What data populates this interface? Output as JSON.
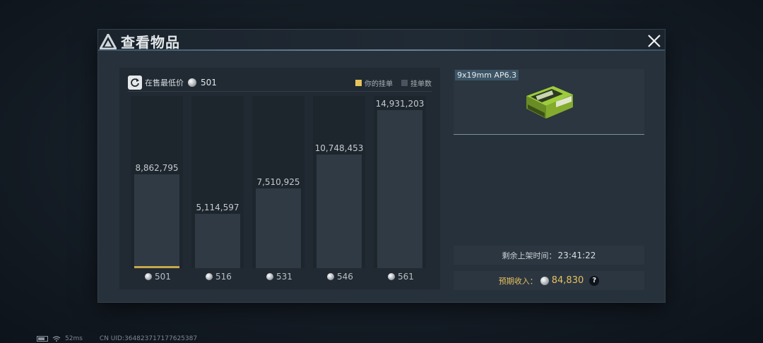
{
  "modal": {
    "title": "查看物品"
  },
  "toolbar": {
    "min_price_label": "在售最低价",
    "min_price_value": "501",
    "legend_mine": "你的挂单",
    "legend_count": "挂单数"
  },
  "chart_data": {
    "type": "bar",
    "categories": [
      "501",
      "516",
      "531",
      "546",
      "561"
    ],
    "values": [
      8862795,
      5114597,
      7510925,
      10748453,
      14931203
    ],
    "value_labels": [
      "8,862,795",
      "5,114,597",
      "7,510,925",
      "10,748,453",
      "14,931,203"
    ],
    "mine_category": "501",
    "ylim": [
      0,
      14931203
    ]
  },
  "item": {
    "name": "9x19mm AP6.3",
    "icon": "ammo-box-icon"
  },
  "timer": {
    "label": "剩余上架时间：",
    "value": "23:41:22"
  },
  "income": {
    "label": "预期收入：",
    "value": "84,830"
  },
  "footer": {
    "ping": "52ms",
    "uid": "CN UID:364823717177625387"
  },
  "colors": {
    "accent": "#e6c15f",
    "bar": "#2f3a44",
    "mine": "#c9a84b"
  }
}
